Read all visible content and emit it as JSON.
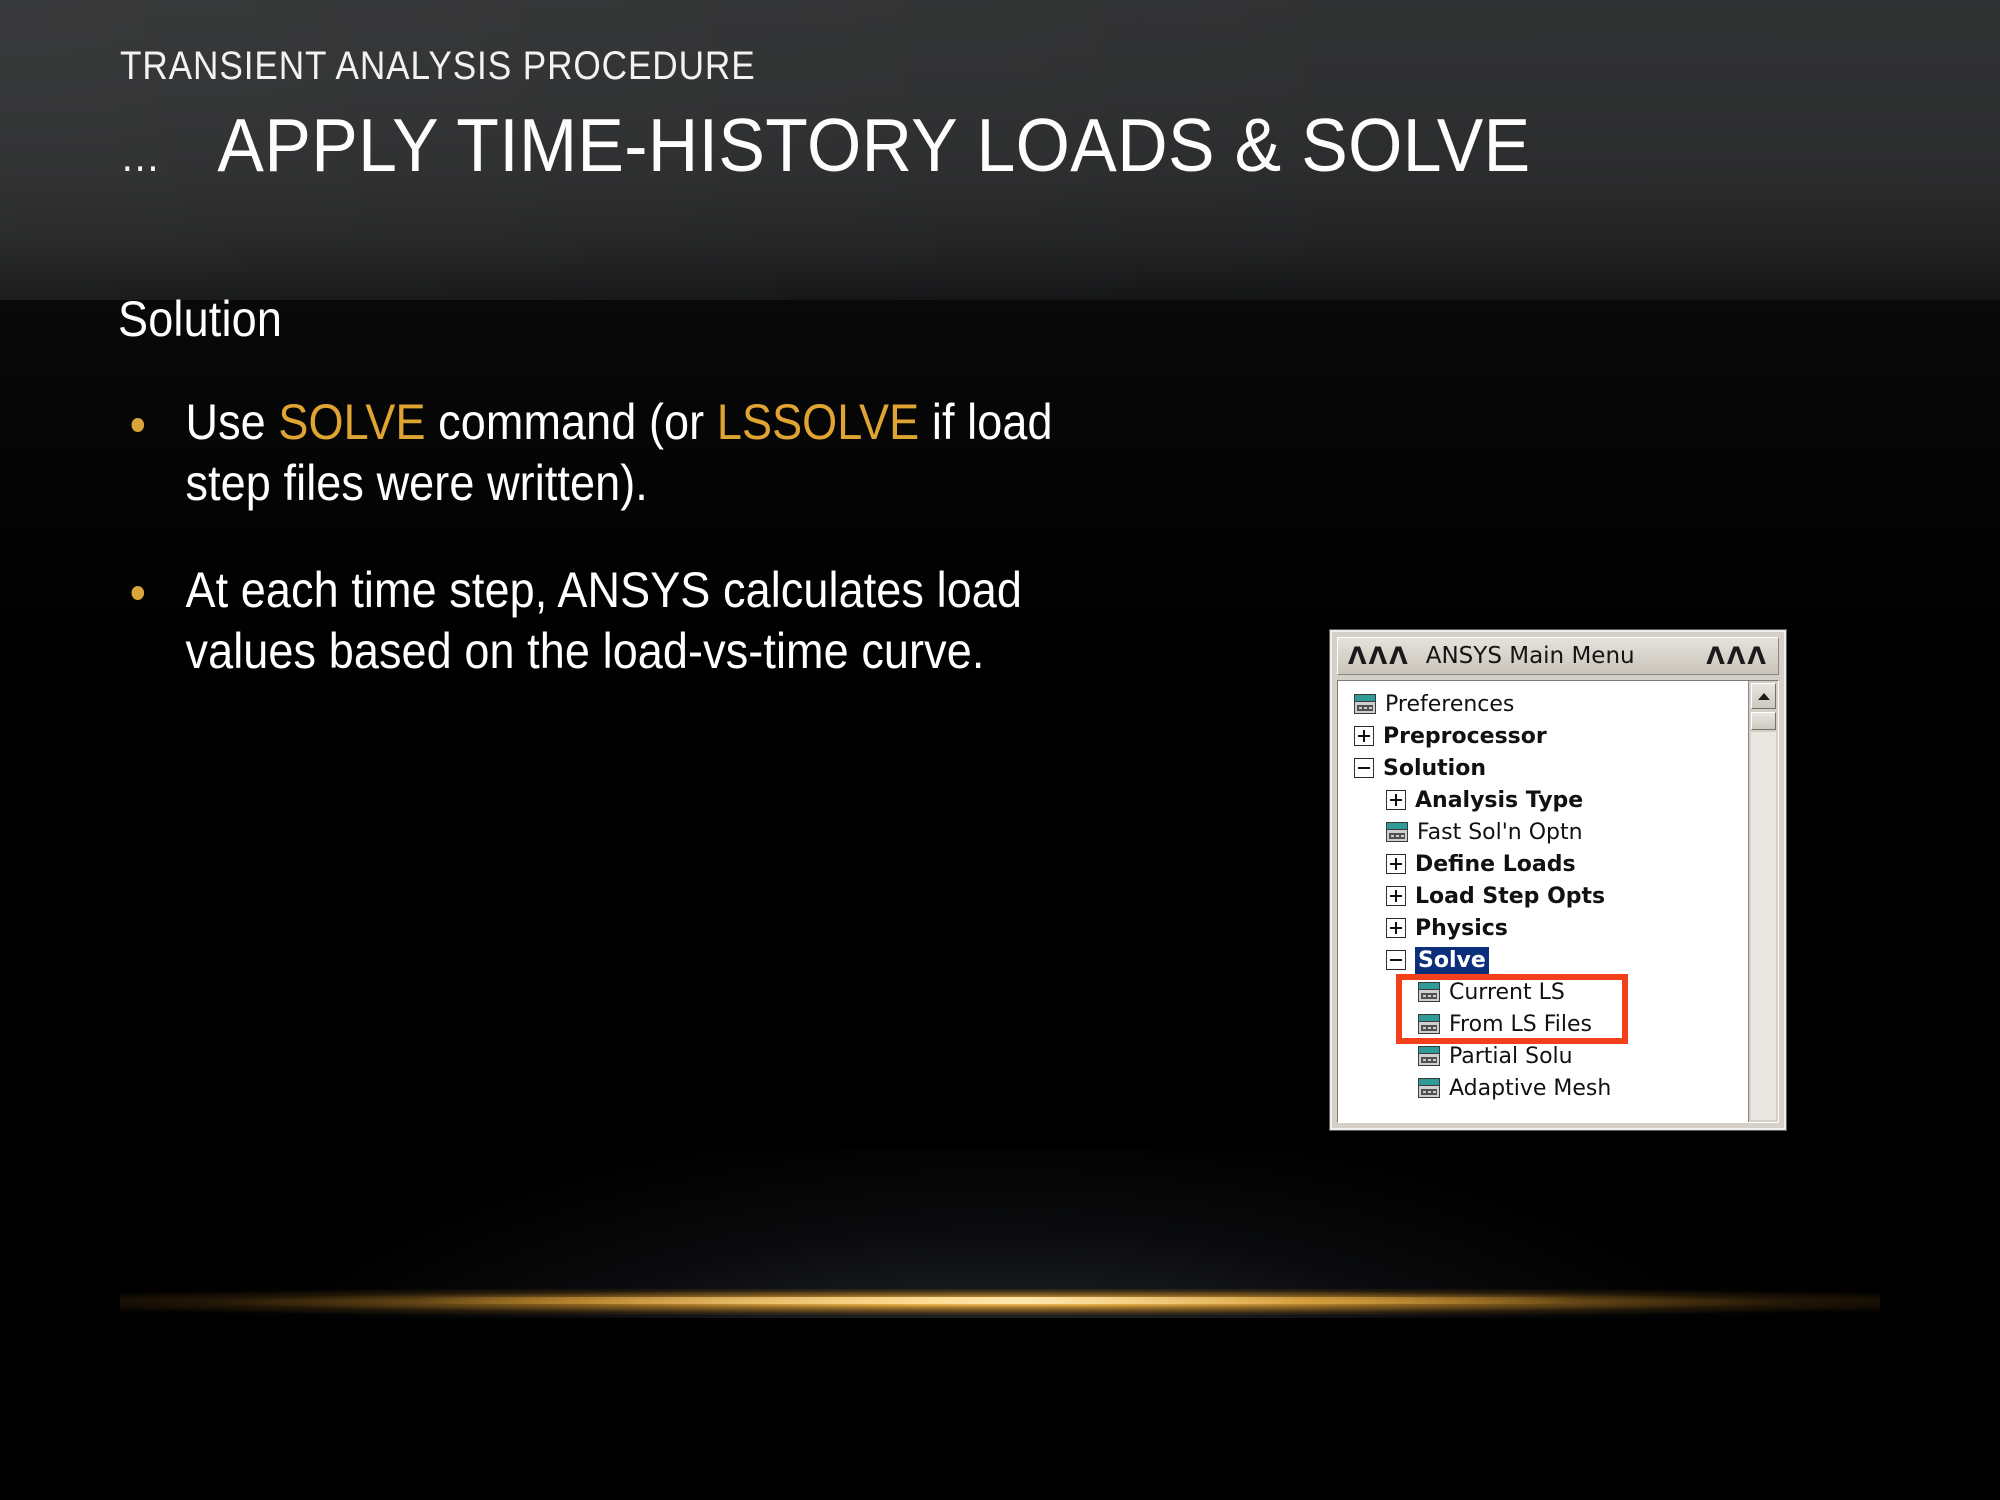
{
  "slide": {
    "eyebrow": "TRANSIENT ANALYSIS PROCEDURE",
    "title_ellipsis": "…",
    "title_main": "APPLY TIME-HISTORY LOADS & SOLVE",
    "lead": "Solution",
    "bullets": [
      {
        "parts": [
          {
            "text": "Use ",
            "style": "plain"
          },
          {
            "text": "SOLVE",
            "style": "keyword"
          },
          {
            "text": " command (or ",
            "style": "plain"
          },
          {
            "text": "LSSOLVE",
            "style": "keyword"
          },
          {
            "text": " if load step files were written).",
            "style": "plain"
          }
        ]
      },
      {
        "parts": [
          {
            "text": "At each time step, ANSYS calculates load values based on the load-vs-time curve.",
            "style": "plain"
          }
        ]
      }
    ]
  },
  "colors": {
    "accent_gold": "#dfa431",
    "bullet_dot": "#d9a43a",
    "text_white": "#ffffff",
    "background": "#000000",
    "highlight_box": "#f4401a",
    "selection_blue": "#0b2f7a",
    "window_face": "#d4d0c8"
  },
  "ansys_window": {
    "titlebar": {
      "left_chevrons": "ΛΛΛ",
      "title": "ANSYS Main Menu",
      "right_chevrons": "ΛΛΛ"
    },
    "tree": [
      {
        "label": "Preferences",
        "icon": "window-icon",
        "indent": 0,
        "bold": false,
        "selected": false,
        "highlighted": false
      },
      {
        "label": "Preprocessor",
        "icon": "expand-plus-icon",
        "indent": 0,
        "bold": true,
        "selected": false,
        "highlighted": false
      },
      {
        "label": "Solution",
        "icon": "collapse-minus-icon",
        "indent": 0,
        "bold": true,
        "selected": false,
        "highlighted": false
      },
      {
        "label": "Analysis Type",
        "icon": "expand-plus-icon",
        "indent": 1,
        "bold": true,
        "selected": false,
        "highlighted": false
      },
      {
        "label": "Fast Sol'n Optn",
        "icon": "window-icon",
        "indent": 1,
        "bold": false,
        "selected": false,
        "highlighted": false
      },
      {
        "label": "Define Loads",
        "icon": "expand-plus-icon",
        "indent": 1,
        "bold": true,
        "selected": false,
        "highlighted": false
      },
      {
        "label": "Load Step Opts",
        "icon": "expand-plus-icon",
        "indent": 1,
        "bold": true,
        "selected": false,
        "highlighted": false
      },
      {
        "label": "Physics",
        "icon": "expand-plus-icon",
        "indent": 1,
        "bold": true,
        "selected": false,
        "highlighted": false
      },
      {
        "label": "Solve",
        "icon": "collapse-minus-icon",
        "indent": 1,
        "bold": true,
        "selected": true,
        "highlighted": false
      },
      {
        "label": "Current LS",
        "icon": "window-icon",
        "indent": 2,
        "bold": false,
        "selected": false,
        "highlighted": true
      },
      {
        "label": "From LS Files",
        "icon": "window-icon",
        "indent": 2,
        "bold": false,
        "selected": false,
        "highlighted": true
      },
      {
        "label": "Partial Solu",
        "icon": "window-icon",
        "indent": 2,
        "bold": false,
        "selected": false,
        "highlighted": false
      },
      {
        "label": "Adaptive Mesh",
        "icon": "window-icon",
        "indent": 2,
        "bold": false,
        "selected": false,
        "highlighted": false
      }
    ],
    "scrollbar": {
      "up_arrow": "scroll-up-icon",
      "position": "top"
    }
  }
}
